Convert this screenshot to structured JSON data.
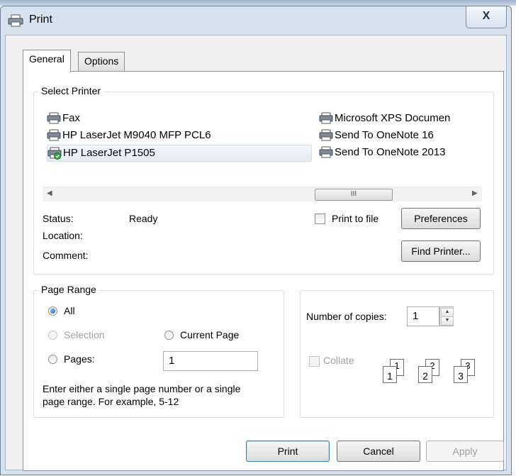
{
  "window": {
    "title": "Print",
    "close_glyph": "X"
  },
  "tabs": [
    {
      "label": "General"
    },
    {
      "label": "Options"
    }
  ],
  "select_printer": {
    "group_label": "Select Printer",
    "printers_col1": [
      {
        "label": "Fax",
        "icon": "fax-printer-icon"
      },
      {
        "label": "HP LaserJet M9040 MFP PCL6",
        "icon": "printer-icon"
      },
      {
        "label": "HP LaserJet P1505",
        "icon": "default-printer-icon",
        "selected": true
      }
    ],
    "printers_col2": [
      {
        "label": "Microsoft XPS Documen",
        "icon": "printer-icon"
      },
      {
        "label": "Send To OneNote 16",
        "icon": "printer-icon"
      },
      {
        "label": "Send To OneNote 2013",
        "icon": "printer-icon"
      }
    ],
    "scroll_thumb_glyph": "III",
    "status_label": "Status:",
    "status_value": "Ready",
    "location_label": "Location:",
    "comment_label": "Comment:",
    "print_to_file_label": "Print to file",
    "preferences_button": "Preferences",
    "find_printer_button": "Find Printer..."
  },
  "page_range": {
    "group_label": "Page Range",
    "all_label": "All",
    "selection_label": "Selection",
    "current_page_label": "Current Page",
    "pages_label": "Pages:",
    "pages_value": "1",
    "help_text_line1": "Enter either a single page number or a single",
    "help_text_line2": "page range.  For example, 5-12"
  },
  "copies": {
    "number_label": "Number of copies:",
    "number_value": "1",
    "collate_label": "Collate",
    "collate_pages": [
      "1",
      "1",
      "2",
      "2",
      "3",
      "3"
    ]
  },
  "footer": {
    "print_button": "Print",
    "cancel_button": "Cancel",
    "apply_button": "Apply"
  },
  "colors": {
    "title_bg": "#d7e2ef",
    "radio_selected": "#1c5fae",
    "disabled_text": "#a0a0a0"
  }
}
